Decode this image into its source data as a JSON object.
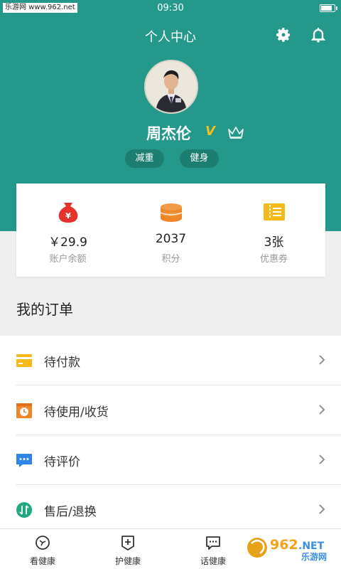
{
  "status": {
    "watermark": "乐游网 www.962.net",
    "time": "09:30"
  },
  "header": {
    "title": "个人中心"
  },
  "profile": {
    "name": "周杰伦",
    "vip_mark": "V",
    "tags": [
      "减重",
      "健身"
    ]
  },
  "stats": [
    {
      "value": "￥29.9",
      "label": "账户余额",
      "icon": "money-bag-icon"
    },
    {
      "value": "2037",
      "label": "积分",
      "icon": "coins-icon"
    },
    {
      "value": "3张",
      "label": "优惠券",
      "icon": "ticket-icon"
    }
  ],
  "orders": {
    "title": "我的订单",
    "items": [
      {
        "label": "待付款",
        "icon": "card-icon"
      },
      {
        "label": "待使用/收货",
        "icon": "clock-box-icon"
      },
      {
        "label": "待评价",
        "icon": "comment-icon"
      },
      {
        "label": "售后/退换",
        "icon": "exchange-icon"
      }
    ]
  },
  "tabs": [
    {
      "label": "看健康"
    },
    {
      "label": "护健康"
    },
    {
      "label": "话健康"
    },
    {
      "label": ""
    }
  ],
  "brand": {
    "watermark_logo": "962.NET 乐游网"
  },
  "colors": {
    "primary": "#24988a",
    "tag_bg": "#1c7d71",
    "red": "#e5322d",
    "orange": "#f0862a",
    "yellow": "#f5b91a",
    "blue": "#2d86e8",
    "green": "#20a882"
  }
}
